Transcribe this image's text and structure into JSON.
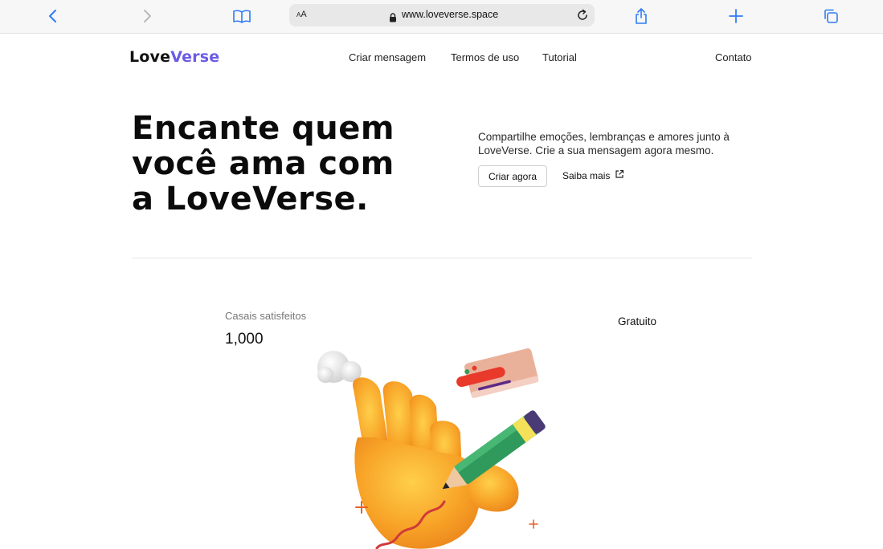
{
  "browser": {
    "url": "www.loveverse.space",
    "reader_label_small": "A",
    "reader_label_big": "A",
    "icons": [
      "back-icon",
      "forward-icon",
      "book-icon",
      "lock-icon",
      "reload-icon",
      "share-icon",
      "plus-icon",
      "tabs-icon"
    ]
  },
  "site": {
    "logo_part1": "Love",
    "logo_part2": "Verse",
    "nav": [
      "Criar mensagem",
      "Termos de uso",
      "Tutorial",
      "Contato"
    ]
  },
  "hero": {
    "title_lines": [
      "Encante quem",
      "você ama com",
      "a LoveVerse."
    ],
    "description": "Compartilhe emoções, lembranças e amores junto à LoveVerse. Crie a sua mensagem agora mesmo.",
    "primary_button": "Criar agora",
    "secondary_link": "Saiba mais"
  },
  "stats": {
    "label": "Casais satisfeitos",
    "value": "1,000",
    "tag": "Gratuito"
  },
  "colors": {
    "accent": "#6b5be6",
    "ios_blue": "#2f7cf6"
  }
}
